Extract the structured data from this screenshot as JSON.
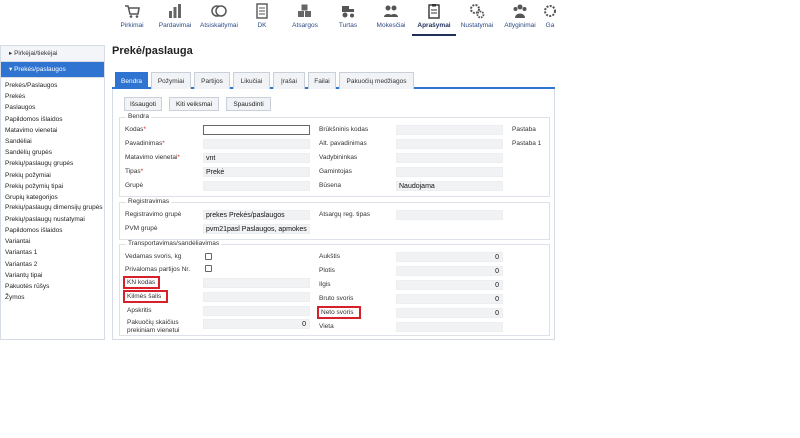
{
  "toolbar": {
    "items": [
      {
        "label": "Pirkimai",
        "icon": "cart-icon"
      },
      {
        "label": "Pardavimai",
        "icon": "bar-chart-icon"
      },
      {
        "label": "Atsiskaitymai",
        "icon": "coins-icon"
      },
      {
        "label": "DK",
        "icon": "ledger-icon"
      },
      {
        "label": "Atsargos",
        "icon": "boxes-icon"
      },
      {
        "label": "Turtas",
        "icon": "tractor-icon"
      },
      {
        "label": "Mokesčiai",
        "icon": "people-icon"
      },
      {
        "label": "Aprašymai",
        "icon": "clipboard-icon"
      },
      {
        "label": "Nustatymai",
        "icon": "gears-icon"
      },
      {
        "label": "Atlyginimai",
        "icon": "employees-icon"
      },
      {
        "label": "Ga",
        "icon": "settings-icon"
      }
    ],
    "active_index": 7
  },
  "sidebar": {
    "sections": [
      {
        "label": "Pirkėjai/tiekėjai",
        "arrow": "▸"
      },
      {
        "label": "Prekės/paslaugos",
        "arrow": "▾"
      }
    ],
    "items": [
      "Prekės/Paslaugos",
      "Prekės",
      "Paslaugos",
      "Papildomos išlaidos",
      "Matavimo vienetai",
      "Sandėliai",
      "Sandėlių grupės",
      "Prekių/paslaugų grupės",
      "Prekių požymiai",
      "Prekių požymių tipai",
      "Grupių kategorijos",
      "Prekių/paslaugų dimensijų grupės",
      "Prekių/paslaugų nustatymai",
      "Papildomos išlaidos",
      "Variantai",
      "Variantas 1",
      "Variantas 2",
      "Variantų tipai",
      "Pakuotės rūšys",
      "Žymos"
    ]
  },
  "page": {
    "title": "Prekė/paslauga"
  },
  "tabs": [
    "Bendra",
    "Požymiai",
    "Partijos",
    "Likučiai",
    "Įrašai",
    "Failai",
    "Pakuočių medžiagos"
  ],
  "buttons": {
    "save": "Išsaugoti",
    "more": "Kiti veiksmai",
    "print": "Spausdinti"
  },
  "bendra": {
    "legend": "Bendra",
    "kodas": {
      "label": "Kodas",
      "value": ""
    },
    "pavadinimas": {
      "label": "Pavadinimas",
      "value": ""
    },
    "matavimo_vienetas": {
      "label": "Matavimo vienetai",
      "value": "vnt"
    },
    "tipas": {
      "label": "Tipas",
      "value": "Prekė"
    },
    "grupe": {
      "label": "Grupė",
      "value": ""
    },
    "brukninis_kodas": {
      "label": "Brūkšninis kodas",
      "value": ""
    },
    "alt_pavadinimas": {
      "label": "Alt. pavadinimas",
      "value": ""
    },
    "vadybininkas": {
      "label": "Vadybininkas",
      "value": ""
    },
    "gamintojas": {
      "label": "Gamintojas",
      "value": ""
    },
    "busena": {
      "label": "Būsena",
      "value": "Naudojama"
    },
    "pastaba": "Pastaba",
    "pastaba1": "Pastaba 1"
  },
  "registravimas": {
    "legend": "Registravimas",
    "registravimo_grupe": {
      "label": "Registravimo grupė",
      "value": "prekes Prekės/paslaugos"
    },
    "pvm_grupe": {
      "label": "PVM grupė",
      "value": "pvm21pasl Paslaugos, apmokes"
    },
    "atsargu_reg_tipas": {
      "label": "Atsargų reg. tipas",
      "value": ""
    }
  },
  "transportavimas": {
    "legend": "Transportavimas/sandėliavimas",
    "vedamas_svoris": {
      "label": "Vedamas svoris, kg",
      "checked": false
    },
    "privalomas_partijos": {
      "label": "Privalomas partijos Nr.",
      "checked": false
    },
    "kn_kodas": {
      "label": "KN kodas",
      "value": ""
    },
    "kilmes_salis": {
      "label": "Kilmės šalis",
      "value": ""
    },
    "apskritis": {
      "label": "Apskritis",
      "value": ""
    },
    "pakuociu_skaicius": {
      "label": "Pakuočių skaičius prekiniam vienetui",
      "value": "0"
    },
    "aukstis": {
      "label": "Aukštis",
      "value": "0"
    },
    "plotis": {
      "label": "Plotis",
      "value": "0"
    },
    "ilgis": {
      "label": "Ilgis",
      "value": "0"
    },
    "bruto_svoris": {
      "label": "Bruto svoris",
      "value": "0"
    },
    "neto_svoris": {
      "label": "Neto svoris",
      "value": "0"
    },
    "vieta": {
      "label": "Vieta",
      "value": ""
    }
  },
  "colors": {
    "accent": "#2f74d0",
    "highlight": "#d8202a"
  }
}
